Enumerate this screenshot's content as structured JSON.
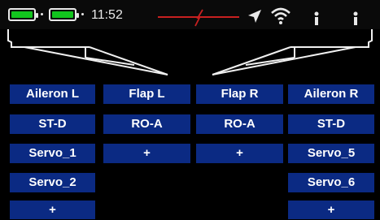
{
  "status_bar": {
    "time": "11:52",
    "battery_level": 1.0,
    "signal_color": "#c82020",
    "icons": [
      "battery-icon",
      "battery-icon",
      "navigation-arrow-icon",
      "wifi-icon",
      "person-icon",
      "person-icon"
    ]
  },
  "colors": {
    "button_bg": "#0b2a83",
    "battery_fill": "#12c51e"
  },
  "grid": {
    "headers": [
      "Aileron L",
      "Flap L",
      "Flap R",
      "Aileron R"
    ],
    "modes": [
      "ST-D",
      "RO-A",
      "RO-A",
      "ST-D"
    ],
    "col1_servos": [
      "Servo_1",
      "Servo_2"
    ],
    "col4_servos": [
      "Servo_5",
      "Servo_6"
    ],
    "add_label": "+"
  }
}
